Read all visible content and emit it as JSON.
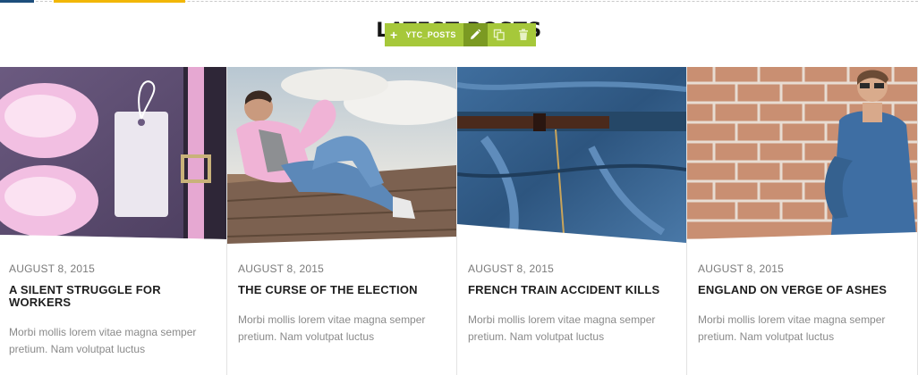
{
  "section": {
    "title": "LATEST POSTS"
  },
  "toolbar": {
    "label": "YTC_POSTS",
    "accent": "#a6c83a",
    "active": "#7b9a22",
    "icons": [
      "plus-icon",
      "pencil-icon",
      "copy-icon",
      "trash-icon"
    ]
  },
  "posts": [
    {
      "date": "AUGUST 8, 2015",
      "title": "A SILENT STRUGGLE FOR WORKERS",
      "excerpt": "Morbi mollis lorem vitae magna semper pretium. Nam volutpat luctus",
      "image": "pink-shoes-and-tag"
    },
    {
      "date": "AUGUST 8, 2015",
      "title": "THE CURSE OF THE ELECTION",
      "excerpt": "Morbi mollis lorem vitae magna semper pretium. Nam volutpat luctus",
      "image": "man-in-pink-shirt-lying"
    },
    {
      "date": "AUGUST 8, 2015",
      "title": "FRENCH TRAIN ACCIDENT KILLS",
      "excerpt": "Morbi mollis lorem vitae magna semper pretium. Nam volutpat luctus",
      "image": "denim-jeans-belt"
    },
    {
      "date": "AUGUST 8, 2015",
      "title": "ENGLAND ON VERGE OF ASHES",
      "excerpt": "Morbi mollis lorem vitae magna semper pretium. Nam volutpat luctus",
      "image": "man-at-brick-wall"
    }
  ]
}
